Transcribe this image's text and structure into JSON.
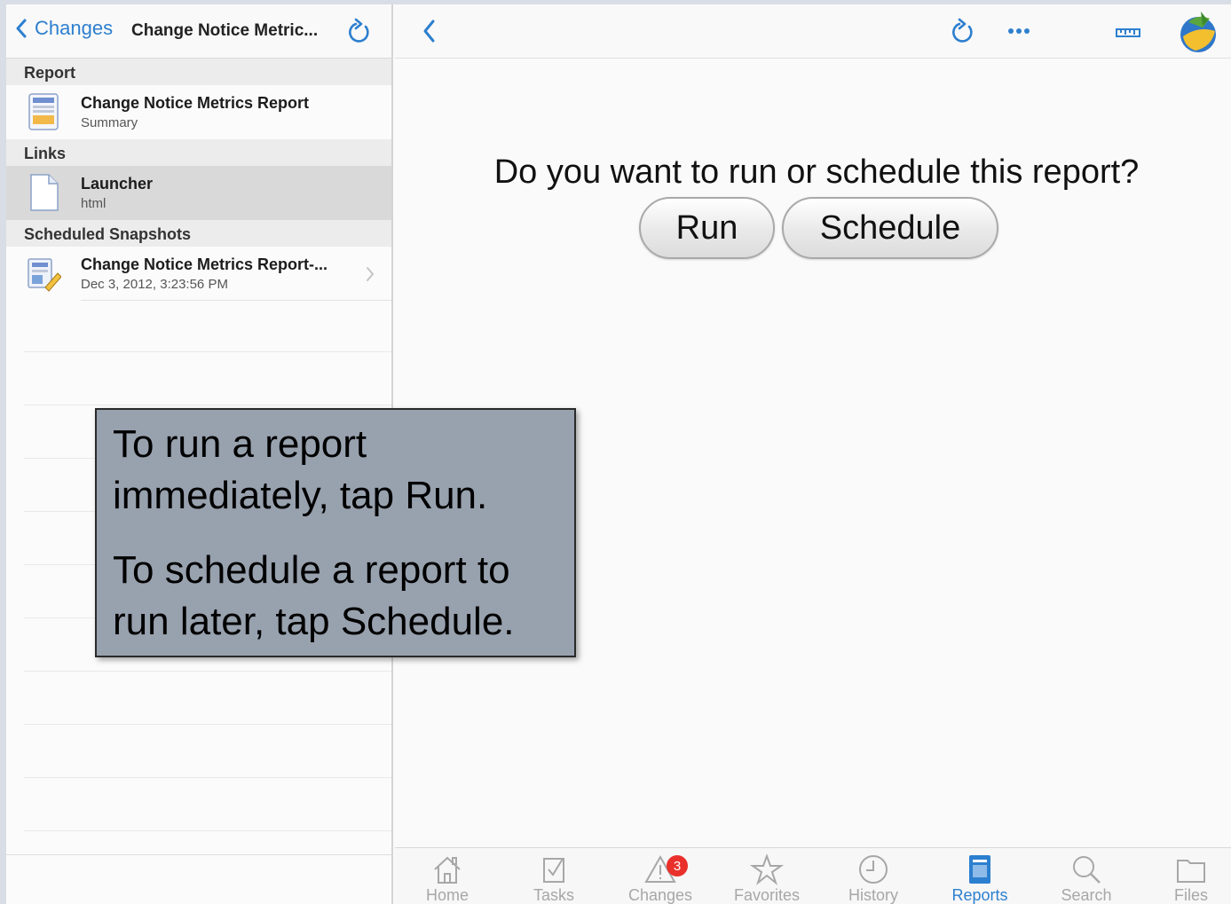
{
  "left_nav": {
    "back_label": "Changes",
    "title": "Change Notice Metric..."
  },
  "sections": {
    "report_header": "Report",
    "links_header": "Links",
    "snapshots_header": "Scheduled Snapshots"
  },
  "report_item": {
    "title": "Change Notice Metrics Report",
    "subtitle": "Summary"
  },
  "links_item": {
    "title": "Launcher",
    "subtitle": "html"
  },
  "snapshot_item": {
    "title": "Change Notice Metrics Report-...",
    "subtitle": "Dec 3, 2012, 3:23:56 PM"
  },
  "main": {
    "prompt": "Do you want to run or schedule this report?",
    "run_label": "Run",
    "schedule_label": "Schedule"
  },
  "tabbar": {
    "home": "Home",
    "tasks": "Tasks",
    "changes": "Changes",
    "changes_badge": "3",
    "favorites": "Favorites",
    "history": "History",
    "reports": "Reports",
    "search": "Search",
    "files": "Files"
  },
  "callout": {
    "line1": "To run a report immediately, tap Run.",
    "line2": "To schedule a report to run later, tap Schedule."
  },
  "colors": {
    "accent": "#2d7fcf",
    "badge": "#e9302b",
    "callout_bg": "#98a1ae",
    "tab_inactive": "#a7a7a7"
  },
  "icons": {
    "back": "chevron-left-icon",
    "refresh": "refresh-icon",
    "more": "more-dots-icon",
    "ruler": "ruler-icon",
    "logo": "app-logo-globe"
  }
}
